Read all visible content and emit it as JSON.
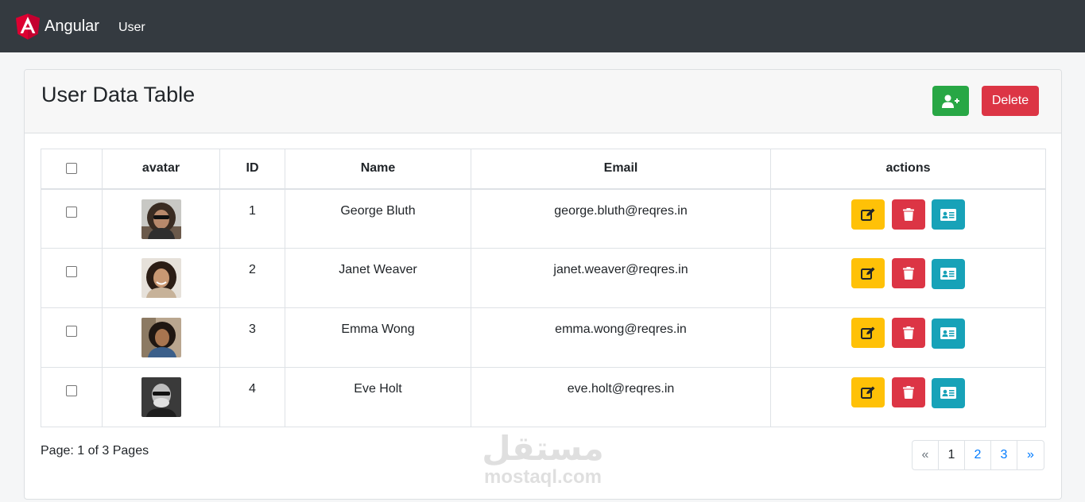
{
  "navbar": {
    "brand": "Angular",
    "links": [
      "User"
    ],
    "brand_color": "#dd0031",
    "background": "#343a40"
  },
  "card": {
    "title": "User Data Table",
    "add_icon": "user-plus-icon",
    "delete_label": "Delete"
  },
  "table": {
    "columns": [
      "",
      "avatar",
      "ID",
      "Name",
      "Email",
      "actions"
    ],
    "rows": [
      {
        "id": "1",
        "name": "George Bluth",
        "email": "george.bluth@reqres.in"
      },
      {
        "id": "2",
        "name": "Janet Weaver",
        "email": "janet.weaver@reqres.in"
      },
      {
        "id": "3",
        "name": "Emma Wong",
        "email": "emma.wong@reqres.in"
      },
      {
        "id": "4",
        "name": "Eve Holt",
        "email": "eve.holt@reqres.in"
      }
    ],
    "row_actions": [
      "edit-icon",
      "trash-icon",
      "id-card-icon"
    ],
    "action_colors": {
      "edit": "#ffc107",
      "delete": "#dc3545",
      "info": "#17a2b8"
    }
  },
  "footer": {
    "page_info": "Page: 1 of 3 Pages",
    "pages": [
      "«",
      "1",
      "2",
      "3",
      "»"
    ]
  },
  "watermark": {
    "arabic": "مستقل",
    "latin": "mostaql.com"
  }
}
